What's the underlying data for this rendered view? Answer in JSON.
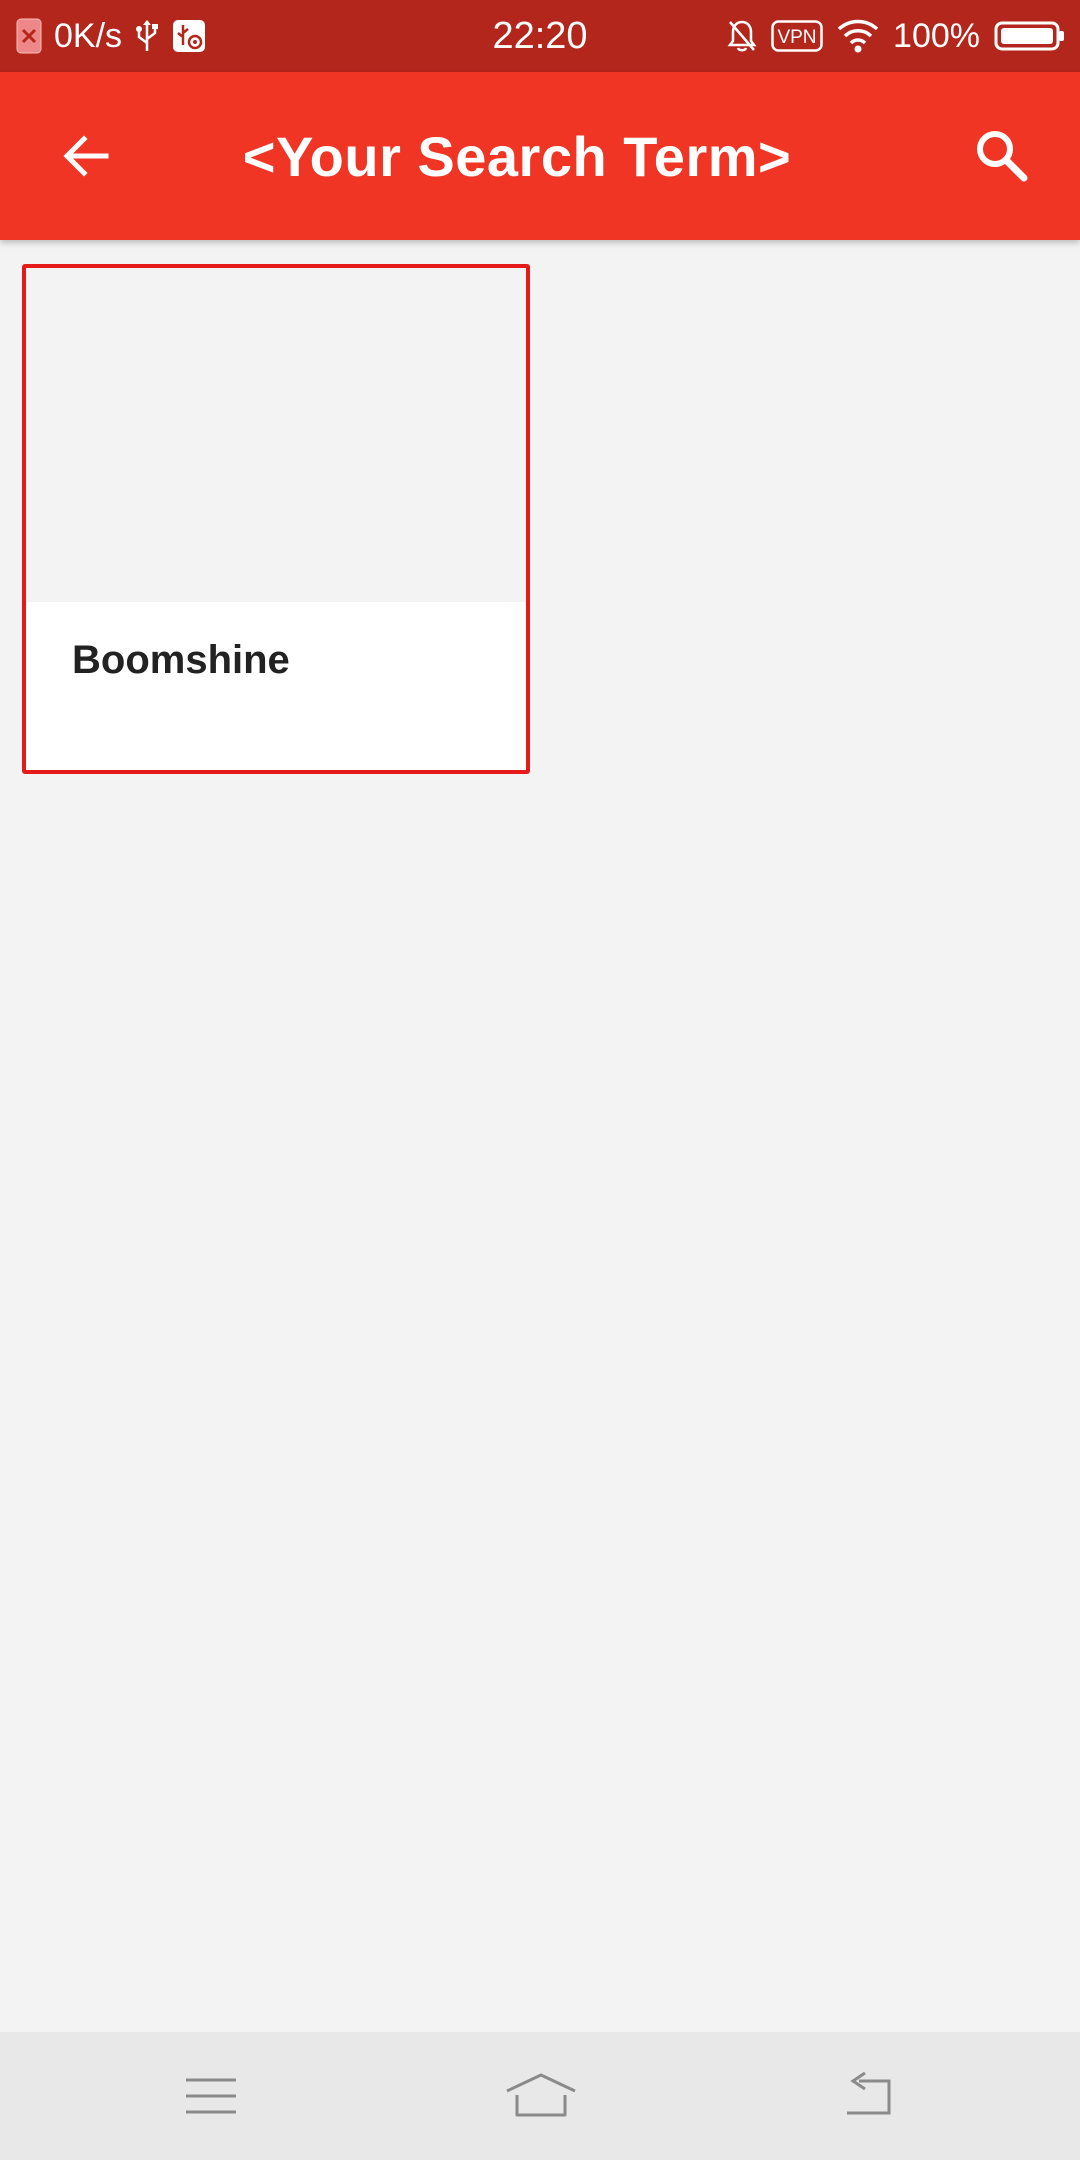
{
  "status_bar": {
    "speed": "0K/s",
    "time": "22:20",
    "vpn": "VPN",
    "battery": "100%"
  },
  "app_bar": {
    "title": "<Your Search Term>"
  },
  "results": [
    {
      "title": "Boomshine"
    }
  ],
  "colors": {
    "status_bar": "#b3261c",
    "app_bar": "#f03524",
    "card_border": "#e51b1b",
    "background": "#f3f3f3",
    "nav_bar": "#e8e8e8"
  },
  "icons": {
    "back": "arrow-left-icon",
    "search": "search-icon",
    "nav_menu": "menu-icon",
    "nav_home": "home-icon",
    "nav_back": "nav-back-icon"
  }
}
